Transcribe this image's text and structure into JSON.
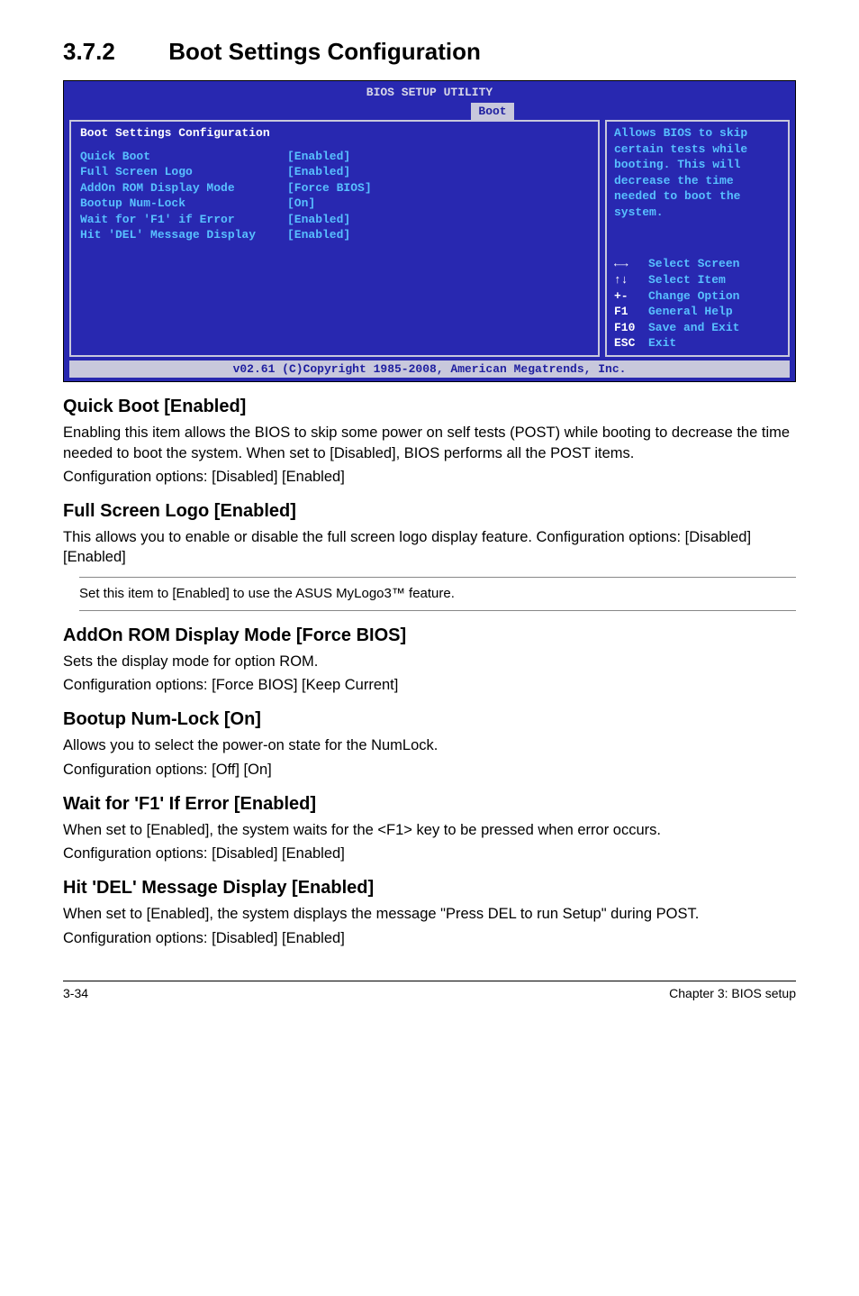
{
  "section": {
    "number": "3.7.2",
    "title": "Boot Settings Configuration"
  },
  "bios": {
    "header": "BIOS SETUP UTILITY",
    "tab": "Boot",
    "left_title": "Boot Settings Configuration",
    "items": [
      {
        "label": "Quick Boot",
        "value": "[Enabled]"
      },
      {
        "label": "Full Screen Logo",
        "value": "[Enabled]"
      },
      {
        "label": "AddOn ROM Display Mode",
        "value": "[Force BIOS]"
      },
      {
        "label": "Bootup Num-Lock",
        "value": "[On]"
      },
      {
        "label": "Wait for 'F1' if Error",
        "value": "[Enabled]"
      },
      {
        "label": "Hit 'DEL' Message Display",
        "value": "[Enabled]"
      }
    ],
    "help_text": "Allows BIOS to skip certain tests while booting. This will decrease the time needed to boot the system.",
    "keys": [
      {
        "k": "←→",
        "l": "Select Screen"
      },
      {
        "k": "↑↓",
        "l": "Select Item"
      },
      {
        "k": "+-",
        "l": "Change Option"
      },
      {
        "k": "F1",
        "l": "General Help"
      },
      {
        "k": "F10",
        "l": "Save and Exit"
      },
      {
        "k": "ESC",
        "l": "Exit"
      }
    ],
    "footer": "v02.61 (C)Copyright 1985-2008, American Megatrends, Inc."
  },
  "quick_boot": {
    "heading": "Quick Boot [Enabled]",
    "p1": "Enabling this item allows the BIOS to skip some power on self tests (POST) while booting to decrease the time needed to boot the system. When set to [Disabled], BIOS performs all the POST items.",
    "p2": "Configuration options: [Disabled] [Enabled]"
  },
  "full_screen": {
    "heading": "Full Screen Logo [Enabled]",
    "p1": "This allows you to enable or disable the full screen logo display feature. Configuration options: [Disabled] [Enabled]"
  },
  "note": {
    "text": "Set this item to [Enabled] to use the ASUS MyLogo3™ feature."
  },
  "addon": {
    "heading": "AddOn ROM Display Mode [Force BIOS]",
    "p1": "Sets the display mode for option ROM.",
    "p2": "Configuration options: [Force BIOS] [Keep Current]"
  },
  "numlock": {
    "heading": "Bootup Num-Lock [On]",
    "p1": "Allows you to select the power-on state for the NumLock.",
    "p2": "Configuration options: [Off] [On]"
  },
  "wait_f1": {
    "heading": "Wait for 'F1' If Error [Enabled]",
    "p1": "When set to [Enabled], the system waits for the <F1> key to be pressed when error occurs.",
    "p2": "Configuration options: [Disabled] [Enabled]"
  },
  "hit_del": {
    "heading": "Hit 'DEL' Message Display [Enabled]",
    "p1": "When set to [Enabled], the system displays the message \"Press DEL to run Setup\" during POST.",
    "p2": "Configuration options: [Disabled] [Enabled]"
  },
  "footer": {
    "left": "3-34",
    "right": "Chapter 3: BIOS setup"
  }
}
